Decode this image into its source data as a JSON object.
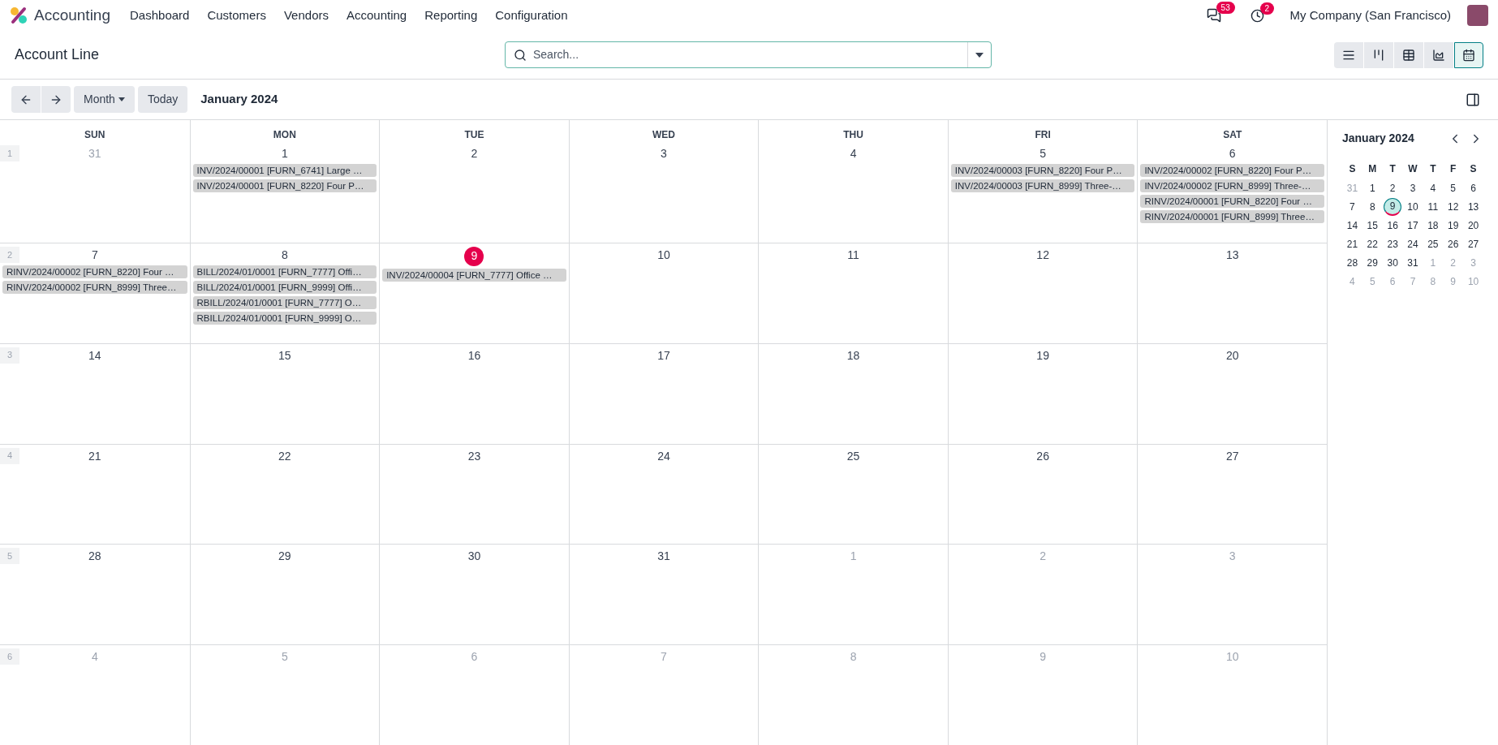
{
  "navbar": {
    "app_name": "Accounting",
    "menu": [
      "Dashboard",
      "Customers",
      "Vendors",
      "Accounting",
      "Reporting",
      "Configuration"
    ],
    "messages_count": "53",
    "activities_count": "2",
    "company": "My Company (San Francisco)"
  },
  "control_panel": {
    "title": "Account Line",
    "search": {
      "placeholder": "Search..."
    },
    "views": [
      {
        "kind": "list",
        "selected": false
      },
      {
        "kind": "kanban",
        "selected": false
      },
      {
        "kind": "pivot",
        "selected": false
      },
      {
        "kind": "graph",
        "selected": false
      },
      {
        "kind": "calendar",
        "selected": true
      }
    ]
  },
  "toolbar": {
    "scale": "Month",
    "today": "Today",
    "period": "January 2024"
  },
  "calendar": {
    "weekdays": [
      "SUN",
      "MON",
      "TUE",
      "WED",
      "THU",
      "FRI",
      "SAT"
    ],
    "weeks": [
      {
        "week_number": "1",
        "days": [
          {
            "day": "31",
            "muted": true,
            "today": false
          },
          {
            "day": "1",
            "muted": false,
            "today": false,
            "events": [
              "INV/2024/00001 [FURN_6741] Large …",
              "INV/2024/00001 [FURN_8220] Four P…"
            ]
          },
          {
            "day": "2",
            "muted": false,
            "today": false
          },
          {
            "day": "3",
            "muted": false,
            "today": false
          },
          {
            "day": "4",
            "muted": false,
            "today": false
          },
          {
            "day": "5",
            "muted": false,
            "today": false,
            "events": [
              "INV/2024/00003 [FURN_8220] Four P…",
              "INV/2024/00003 [FURN_8999] Three-…"
            ]
          },
          {
            "day": "6",
            "muted": false,
            "today": false,
            "events": [
              "INV/2024/00002 [FURN_8220] Four P…",
              "INV/2024/00002 [FURN_8999] Three-…",
              "RINV/2024/00001 [FURN_8220] Four …",
              "RINV/2024/00001 [FURN_8999] Three…"
            ]
          }
        ]
      },
      {
        "week_number": "2",
        "days": [
          {
            "day": "7",
            "muted": false,
            "today": false,
            "events": [
              "RINV/2024/00002 [FURN_8220] Four …",
              "RINV/2024/00002 [FURN_8999] Three…"
            ]
          },
          {
            "day": "8",
            "muted": false,
            "today": false,
            "events": [
              "BILL/2024/01/0001 [FURN_7777] Offi…",
              "BILL/2024/01/0001 [FURN_9999] Offi…",
              "RBILL/2024/01/0001 [FURN_7777] O…",
              "RBILL/2024/01/0001 [FURN_9999] O…"
            ]
          },
          {
            "day": "9",
            "muted": false,
            "today": true,
            "events": [
              "INV/2024/00004 [FURN_7777] Office …"
            ]
          },
          {
            "day": "10",
            "muted": false,
            "today": false
          },
          {
            "day": "11",
            "muted": false,
            "today": false
          },
          {
            "day": "12",
            "muted": false,
            "today": false
          },
          {
            "day": "13",
            "muted": false,
            "today": false
          }
        ]
      },
      {
        "week_number": "3",
        "days": [
          {
            "day": "14",
            "muted": false,
            "today": false
          },
          {
            "day": "15",
            "muted": false,
            "today": false
          },
          {
            "day": "16",
            "muted": false,
            "today": false
          },
          {
            "day": "17",
            "muted": false,
            "today": false
          },
          {
            "day": "18",
            "muted": false,
            "today": false
          },
          {
            "day": "19",
            "muted": false,
            "today": false
          },
          {
            "day": "20",
            "muted": false,
            "today": false
          }
        ]
      },
      {
        "week_number": "4",
        "days": [
          {
            "day": "21",
            "muted": false,
            "today": false
          },
          {
            "day": "22",
            "muted": false,
            "today": false
          },
          {
            "day": "23",
            "muted": false,
            "today": false
          },
          {
            "day": "24",
            "muted": false,
            "today": false
          },
          {
            "day": "25",
            "muted": false,
            "today": false
          },
          {
            "day": "26",
            "muted": false,
            "today": false
          },
          {
            "day": "27",
            "muted": false,
            "today": false
          }
        ]
      },
      {
        "week_number": "5",
        "days": [
          {
            "day": "28",
            "muted": false,
            "today": false
          },
          {
            "day": "29",
            "muted": false,
            "today": false
          },
          {
            "day": "30",
            "muted": false,
            "today": false
          },
          {
            "day": "31",
            "muted": false,
            "today": false
          },
          {
            "day": "1",
            "muted": true,
            "today": false
          },
          {
            "day": "2",
            "muted": true,
            "today": false
          },
          {
            "day": "3",
            "muted": true,
            "today": false
          }
        ]
      },
      {
        "week_number": "6",
        "days": [
          {
            "day": "4",
            "muted": true,
            "today": false
          },
          {
            "day": "5",
            "muted": true,
            "today": false
          },
          {
            "day": "6",
            "muted": true,
            "today": false
          },
          {
            "day": "7",
            "muted": true,
            "today": false
          },
          {
            "day": "8",
            "muted": true,
            "today": false
          },
          {
            "day": "9",
            "muted": true,
            "today": false
          },
          {
            "day": "10",
            "muted": true,
            "today": false
          }
        ]
      }
    ]
  },
  "mini_calendar": {
    "title": "January 2024",
    "weekdays": [
      "S",
      "M",
      "T",
      "W",
      "T",
      "F",
      "S"
    ],
    "weeks": [
      [
        {
          "day": "31",
          "muted": true,
          "selected": false,
          "today": false
        },
        {
          "day": "1",
          "muted": false,
          "selected": false,
          "today": false
        },
        {
          "day": "2",
          "muted": false,
          "selected": false,
          "today": false
        },
        {
          "day": "3",
          "muted": false,
          "selected": false,
          "today": false
        },
        {
          "day": "4",
          "muted": false,
          "selected": false,
          "today": false
        },
        {
          "day": "5",
          "muted": false,
          "selected": false,
          "today": false
        },
        {
          "day": "6",
          "muted": false,
          "selected": false,
          "today": false
        }
      ],
      [
        {
          "day": "7",
          "muted": false,
          "selected": false,
          "today": false
        },
        {
          "day": "8",
          "muted": false,
          "selected": false,
          "today": false
        },
        {
          "day": "9",
          "muted": false,
          "selected": true,
          "today": true
        },
        {
          "day": "10",
          "muted": false,
          "selected": false,
          "today": false
        },
        {
          "day": "11",
          "muted": false,
          "selected": false,
          "today": false
        },
        {
          "day": "12",
          "muted": false,
          "selected": false,
          "today": false
        },
        {
          "day": "13",
          "muted": false,
          "selected": false,
          "today": false
        }
      ],
      [
        {
          "day": "14",
          "muted": false,
          "selected": false,
          "today": false
        },
        {
          "day": "15",
          "muted": false,
          "selected": false,
          "today": false
        },
        {
          "day": "16",
          "muted": false,
          "selected": false,
          "today": false
        },
        {
          "day": "17",
          "muted": false,
          "selected": false,
          "today": false
        },
        {
          "day": "18",
          "muted": false,
          "selected": false,
          "today": false
        },
        {
          "day": "19",
          "muted": false,
          "selected": false,
          "today": false
        },
        {
          "day": "20",
          "muted": false,
          "selected": false,
          "today": false
        }
      ],
      [
        {
          "day": "21",
          "muted": false,
          "selected": false,
          "today": false
        },
        {
          "day": "22",
          "muted": false,
          "selected": false,
          "today": false
        },
        {
          "day": "23",
          "muted": false,
          "selected": false,
          "today": false
        },
        {
          "day": "24",
          "muted": false,
          "selected": false,
          "today": false
        },
        {
          "day": "25",
          "muted": false,
          "selected": false,
          "today": false
        },
        {
          "day": "26",
          "muted": false,
          "selected": false,
          "today": false
        },
        {
          "day": "27",
          "muted": false,
          "selected": false,
          "today": false
        }
      ],
      [
        {
          "day": "28",
          "muted": false,
          "selected": false,
          "today": false
        },
        {
          "day": "29",
          "muted": false,
          "selected": false,
          "today": false
        },
        {
          "day": "30",
          "muted": false,
          "selected": false,
          "today": false
        },
        {
          "day": "31",
          "muted": false,
          "selected": false,
          "today": false
        },
        {
          "day": "1",
          "muted": true,
          "selected": false,
          "today": false
        },
        {
          "day": "2",
          "muted": true,
          "selected": false,
          "today": false
        },
        {
          "day": "3",
          "muted": true,
          "selected": false,
          "today": false
        }
      ],
      [
        {
          "day": "4",
          "muted": true,
          "selected": false,
          "today": false
        },
        {
          "day": "5",
          "muted": true,
          "selected": false,
          "today": false
        },
        {
          "day": "6",
          "muted": true,
          "selected": false,
          "today": false
        },
        {
          "day": "7",
          "muted": true,
          "selected": false,
          "today": false
        },
        {
          "day": "8",
          "muted": true,
          "selected": false,
          "today": false
        },
        {
          "day": "9",
          "muted": true,
          "selected": false,
          "today": false
        },
        {
          "day": "10",
          "muted": true,
          "selected": false,
          "today": false
        }
      ]
    ]
  }
}
